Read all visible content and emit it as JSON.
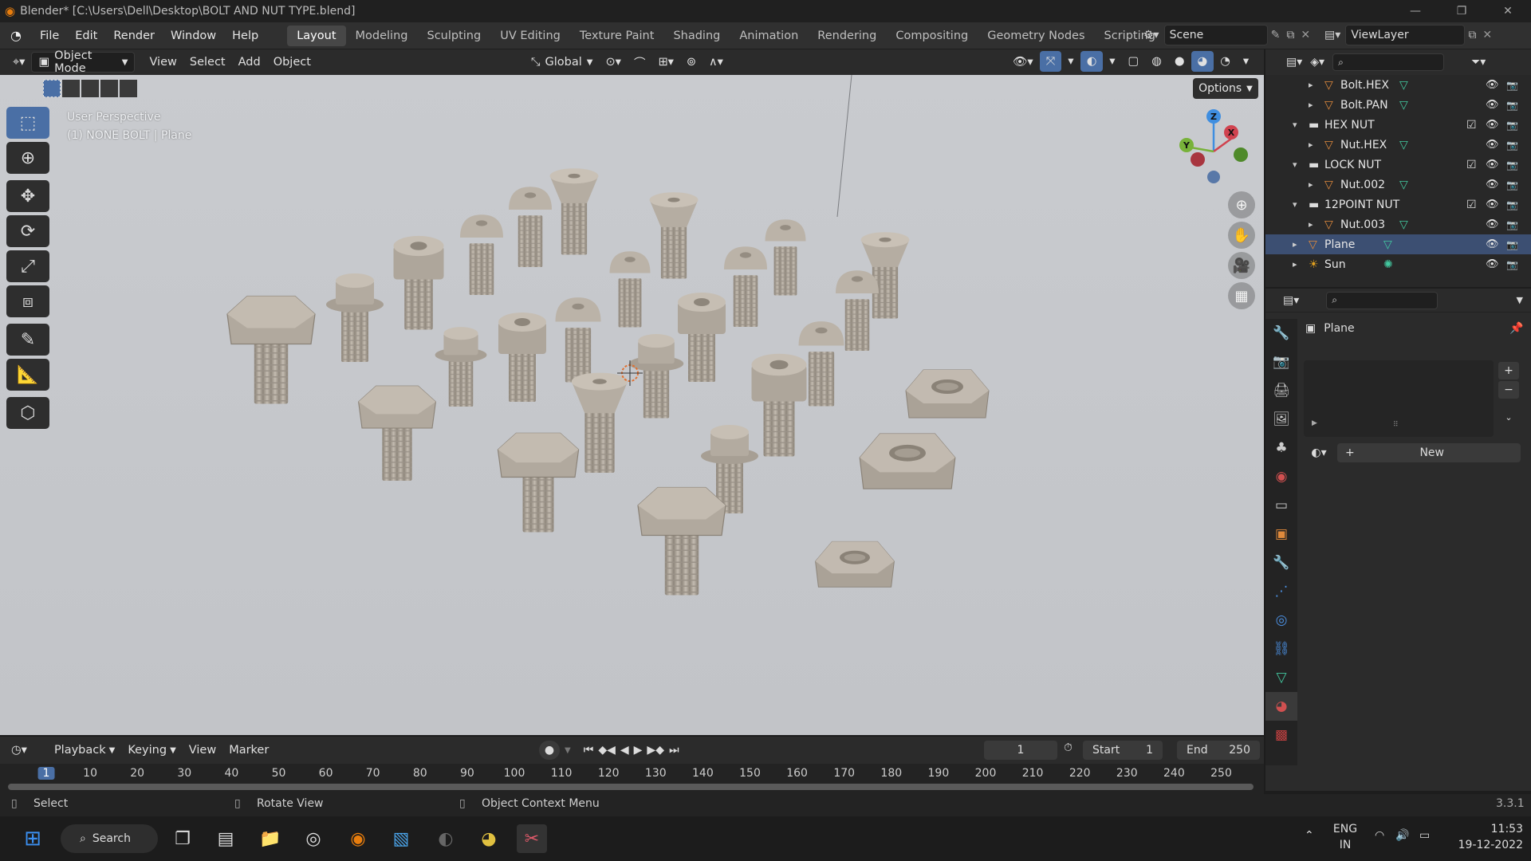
{
  "window": {
    "title": "Blender* [C:\\Users\\Dell\\Desktop\\BOLT AND NUT TYPE.blend]",
    "minimize": "—",
    "maximize": "❐",
    "close": "✕"
  },
  "menu": [
    "File",
    "Edit",
    "Render",
    "Window",
    "Help"
  ],
  "workspaces": [
    "Layout",
    "Modeling",
    "Sculpting",
    "UV Editing",
    "Texture Paint",
    "Shading",
    "Animation",
    "Rendering",
    "Compositing",
    "Geometry Nodes",
    "Scripting"
  ],
  "active_workspace": "Layout",
  "scene": {
    "label": "Scene",
    "view_layer": "ViewLayer"
  },
  "viewport_header": {
    "mode": "Object Mode",
    "menus": [
      "View",
      "Select",
      "Add",
      "Object"
    ],
    "transform_orientation": "Global"
  },
  "viewport": {
    "perspective": "User Perspective",
    "context": "(1) NONE BOLT | Plane",
    "options_label": "Options",
    "gizmo": {
      "x": "X",
      "y": "Y",
      "z": "Z"
    }
  },
  "outliner": {
    "rows": [
      {
        "label": "Bolt.HEX",
        "kind": "mesh",
        "indent": 2
      },
      {
        "label": "Bolt.PAN",
        "kind": "mesh",
        "indent": 2
      },
      {
        "label": "HEX NUT",
        "kind": "collection",
        "indent": 1
      },
      {
        "label": "Nut.HEX",
        "kind": "mesh",
        "indent": 2
      },
      {
        "label": "LOCK NUT",
        "kind": "collection",
        "indent": 1
      },
      {
        "label": "Nut.002",
        "kind": "mesh",
        "indent": 2
      },
      {
        "label": "12POINT NUT",
        "kind": "collection",
        "indent": 1
      },
      {
        "label": "Nut.003",
        "kind": "mesh",
        "indent": 2
      },
      {
        "label": "Plane",
        "kind": "mesh",
        "indent": 1,
        "selected": true
      },
      {
        "label": "Sun",
        "kind": "light",
        "indent": 1
      }
    ]
  },
  "properties": {
    "object_name": "Plane",
    "new_button": "New"
  },
  "timeline": {
    "menus": [
      "Playback",
      "Keying",
      "View",
      "Marker"
    ],
    "current_frame": "1",
    "start_label": "Start",
    "start_value": "1",
    "end_label": "End",
    "end_value": "250",
    "ruler": [
      "1",
      "10",
      "20",
      "30",
      "40",
      "50",
      "60",
      "70",
      "80",
      "90",
      "100",
      "110",
      "120",
      "130",
      "140",
      "150",
      "160",
      "170",
      "180",
      "190",
      "200",
      "210",
      "220",
      "230",
      "240",
      "250"
    ]
  },
  "statusbar": {
    "select": "Select",
    "rotate": "Rotate View",
    "context_menu": "Object Context Menu",
    "version": "3.3.1"
  },
  "taskbar": {
    "search": "Search",
    "lang_top": "ENG",
    "lang_bottom": "IN",
    "time": "11:53",
    "date": "19-12-2022"
  },
  "colors": {
    "accent_blue": "#4a6fa5",
    "selected_row": "#3c4f72",
    "mesh_icon": "#e08a3c",
    "data_icon": "#43c9a0",
    "axis_x": "#d0434f",
    "axis_y": "#78b23a",
    "axis_z": "#3f8ee0"
  }
}
